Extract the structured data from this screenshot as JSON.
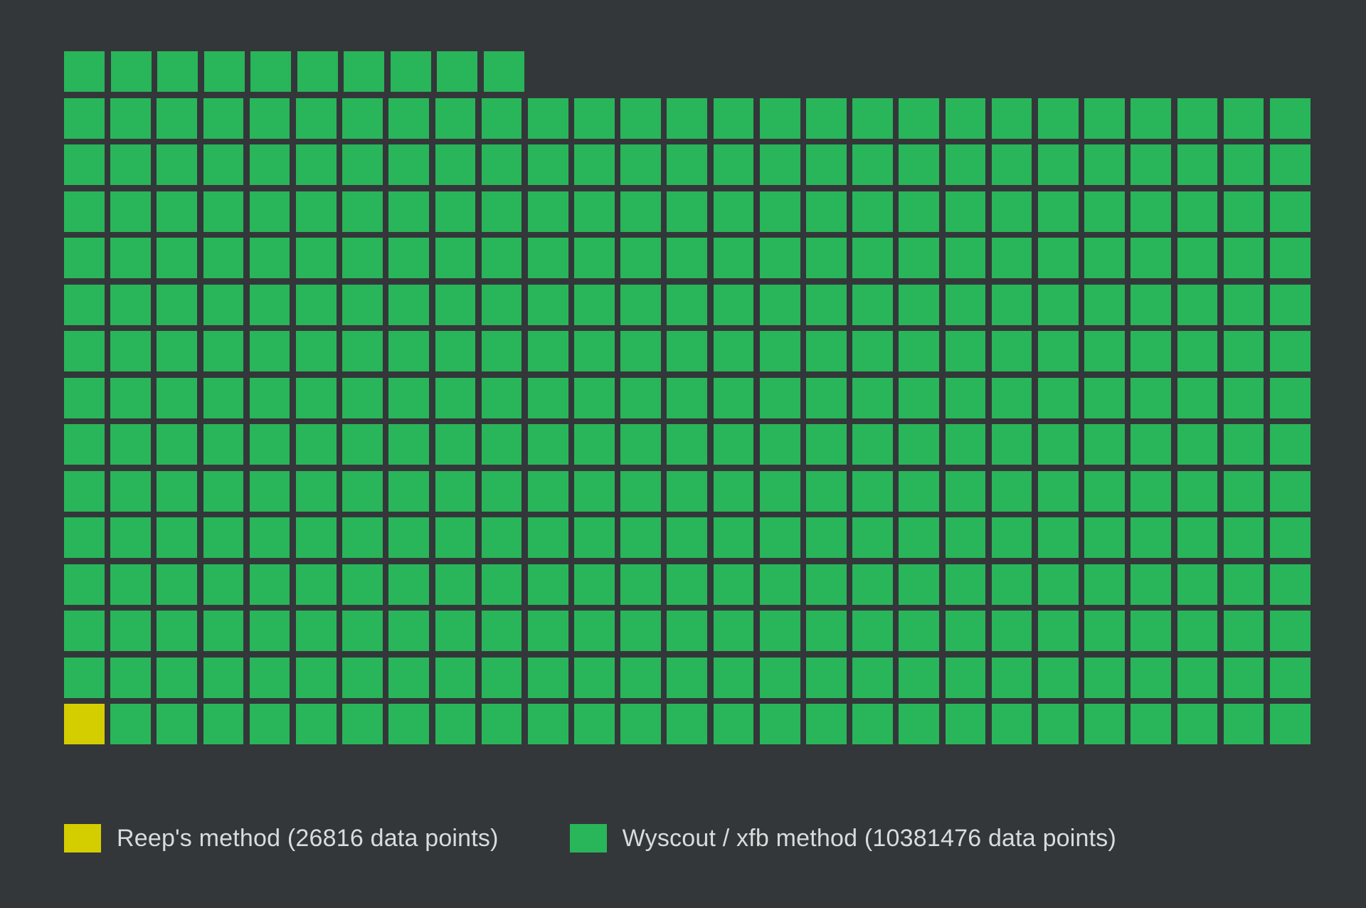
{
  "chart_data": {
    "type": "pictogram",
    "unit_value": 26816,
    "series": [
      {
        "name": "Reep's method",
        "data_points": 26816,
        "units": 1,
        "color": "#d4cd00"
      },
      {
        "name": "Wyscout / xfb method",
        "data_points": 10381476,
        "units": 387,
        "color": "#29b559"
      }
    ],
    "grid": {
      "columns": 27,
      "fill_from": "bottom-left",
      "rows_full": 14,
      "top_row_units": 10
    }
  },
  "legend": {
    "items": [
      {
        "label": "Reep's method (26816 data points)",
        "color": "#d4cd00"
      },
      {
        "label": "Wyscout / xfb method (10381476 data points)",
        "color": "#29b559"
      }
    ]
  },
  "colors": {
    "bg": "#33373a",
    "text": "#d9dbdc"
  }
}
